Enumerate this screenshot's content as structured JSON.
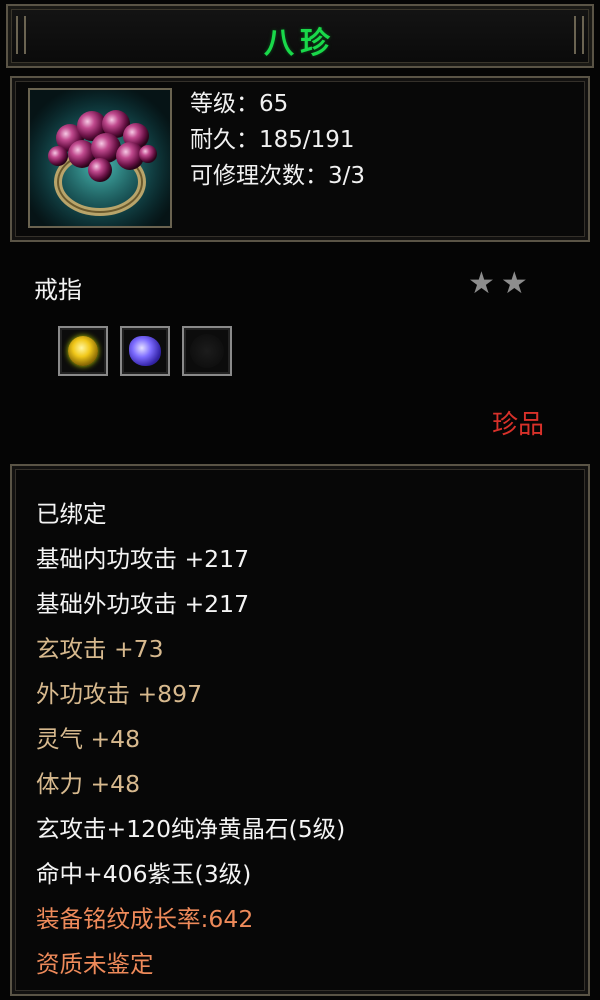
{
  "title": "八珍",
  "colors": {
    "title": "#19d94a",
    "rarity": "#d8312a",
    "white_stat": "#f4f4f4",
    "tan_stat": "#d7b98e",
    "orange_stat": "#ee8a5a"
  },
  "header": {
    "icon": "grape-ring-icon",
    "level": "等级：65",
    "durability": "耐久：185/191",
    "repairs": "可修理次数：3/3"
  },
  "item_type": "戒指",
  "stars": "★★",
  "sockets": [
    {
      "icon": "yellow-gem-icon"
    },
    {
      "icon": "purple-gem-icon"
    },
    {
      "icon": "empty-socket-icon"
    }
  ],
  "rarity": "珍品",
  "attributes": [
    {
      "text": "已绑定",
      "color": "white"
    },
    {
      "text": "基础内功攻击  +217",
      "color": "white"
    },
    {
      "text": "基础外功攻击  +217",
      "color": "white"
    },
    {
      "text": "玄攻击  +73",
      "color": "tan"
    },
    {
      "text": "外功攻击  +897",
      "color": "tan"
    },
    {
      "text": "灵气  +48",
      "color": "tan"
    },
    {
      "text": "体力  +48",
      "color": "tan"
    },
    {
      "text": "玄攻击+120纯净黄晶石(5级)",
      "color": "white"
    },
    {
      "text": "命中+406紫玉(3级)",
      "color": "white"
    },
    {
      "text": "装备铭纹成长率:642",
      "color": "orange"
    },
    {
      "text": "资质未鉴定",
      "color": "orange"
    }
  ]
}
